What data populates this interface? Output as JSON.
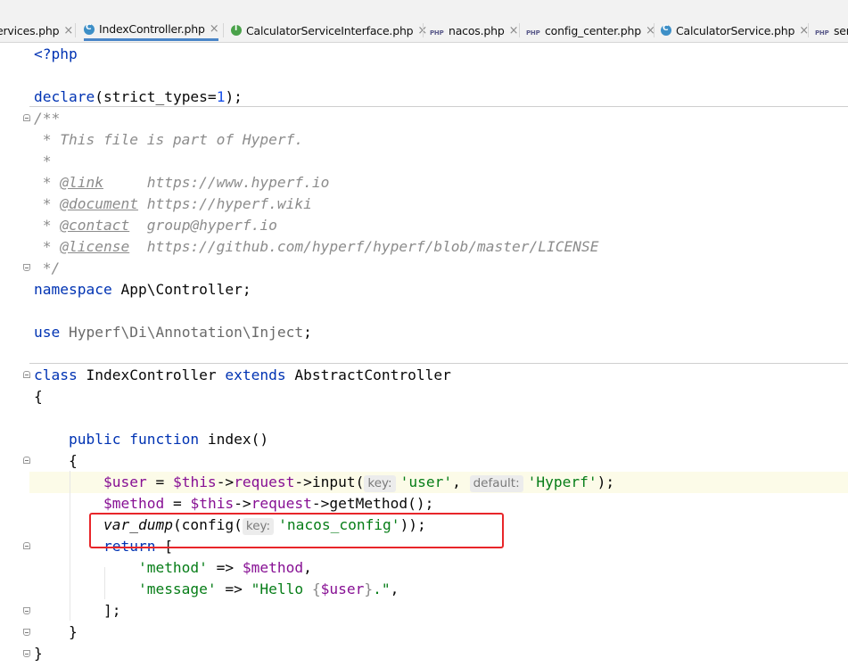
{
  "tabs": [
    {
      "label": "ervices.php",
      "icon": "php"
    },
    {
      "label": "IndexController.php",
      "icon": "class",
      "active": true
    },
    {
      "label": "CalculatorServiceInterface.php",
      "icon": "interface"
    },
    {
      "label": "nacos.php",
      "icon": "php"
    },
    {
      "label": "config_center.php",
      "icon": "php"
    },
    {
      "label": "CalculatorService.php",
      "icon": "class"
    },
    {
      "label": "ser",
      "icon": "php"
    }
  ],
  "tab_close_glyph": "×",
  "php_badge": "PHP",
  "code": {
    "l1": "<?php",
    "l3_kw": "declare",
    "l3_a": "(strict_types=",
    "l3_num": "1",
    "l3_b": ");",
    "l4": "/**",
    "l5": " * This file is part of Hyperf.",
    "l6": " *",
    "l7_a": " * ",
    "l7_tag": "@link",
    "l7_b": "     https://www.hyperf.io",
    "l8_a": " * ",
    "l8_tag": "@document",
    "l8_b": " https://hyperf.wiki",
    "l9_a": " * ",
    "l9_tag": "@contact",
    "l9_b": "  group@hyperf.io",
    "l10_a": " * ",
    "l10_tag": "@license",
    "l10_b": "  https://github.com/hyperf/hyperf/blob/master/LICENSE",
    "l11": " */",
    "l12_kw": "namespace",
    "l12_b": " App\\Controller;",
    "l14_kw": "use",
    "l14_b": " Hyperf\\Di\\Annotation\\Inject",
    "l14_c": ";",
    "l16_kw": "class",
    "l16_b": " IndexController ",
    "l16_kw2": "extends",
    "l16_c": " AbstractController",
    "l17": "{",
    "l19_kw": "    public function",
    "l19_b": " index()",
    "l20": "    {",
    "l21_a": "        ",
    "l21_var": "$user",
    "l21_b": " = ",
    "l21_this": "$this",
    "l21_c": "->",
    "l21_req": "request",
    "l21_d": "->input(",
    "l21_hint1": "key:",
    "l21_s1": "'user'",
    "l21_e": ", ",
    "l21_hint2": "default:",
    "l21_s2": "'Hyperf'",
    "l21_f": ");",
    "l22_a": "        ",
    "l22_var": "$method",
    "l22_b": " = ",
    "l22_this": "$this",
    "l22_c": "->",
    "l22_req": "request",
    "l22_d": "->getMethod();",
    "l23_a": "        ",
    "l23_fn": "var_dump",
    "l23_b": "(config(",
    "l23_hint": "key:",
    "l23_s": "'nacos_config'",
    "l23_c": "));",
    "l24_kw": "        return",
    "l24_b": " [",
    "l25_a": "            ",
    "l25_s": "'method'",
    "l25_b": " => ",
    "l25_var": "$method",
    "l25_c": ",",
    "l26_a": "            ",
    "l26_s": "'message'",
    "l26_b": " => ",
    "l26_s2": "\"Hello ",
    "l26_br1": "{",
    "l26_var": "$user",
    "l26_br2": "}",
    "l26_s3": ".\"",
    "l26_c": ",",
    "l27": "        ];",
    "l28": "    }",
    "l29": "}"
  },
  "colors": {
    "keyword": "#0033b3",
    "string": "#067d17",
    "variable": "#871094",
    "comment": "#8c8c8c",
    "highlight_box": "#e8262a",
    "active_tab": "#4a86c8"
  }
}
